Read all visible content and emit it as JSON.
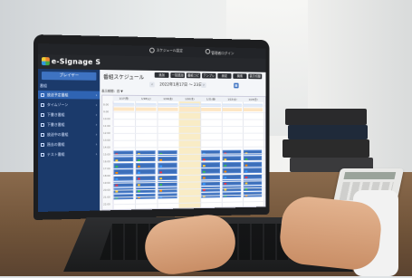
{
  "app": {
    "logo_text": "e-Signage S",
    "top_center_label": "スケジュール設定",
    "top_user_label": "管理者ログイン"
  },
  "sidebar": {
    "player_button": "プレイヤー",
    "section_label": "番組",
    "items": [
      {
        "label": "放送予定番組",
        "active": true
      },
      {
        "label": "タイムゾーン",
        "active": false
      },
      {
        "label": "下書き番組",
        "active": false
      },
      {
        "label": "下書き番組",
        "active": false
      },
      {
        "label": "放送中の番組",
        "active": false
      },
      {
        "label": "過去の番組",
        "active": false
      },
      {
        "label": "テスト番組",
        "active": false
      }
    ]
  },
  "main": {
    "title": "番組スケジュール",
    "toolbar": [
      "追加",
      "一括追加",
      "番組コピー",
      "テンプレ",
      "設定",
      "検索",
      "表示切替"
    ],
    "date_label": "2022年1月17日 ～ 23日",
    "filter_label": "表示期間：週 ▼",
    "days": [
      "1/17(月)",
      "1/18(火)",
      "1/19(水)",
      "1/20(木)",
      "1/21(金)",
      "1/22(土)",
      "1/23(日)"
    ],
    "today_index": 3,
    "times": [
      "8:00",
      "9:00",
      "10:00",
      "11:00",
      "12:00",
      "13:00",
      "14:00",
      "15:00",
      "16:00",
      "17:00",
      "18:00",
      "19:00",
      "20:00",
      "21:00",
      "22:00"
    ]
  },
  "colors": {
    "sidebar_bg": "#1b3a6b",
    "accent": "#3e73c2",
    "event_block": "#3c6fba",
    "today_highlight": "#f9ecc6"
  }
}
